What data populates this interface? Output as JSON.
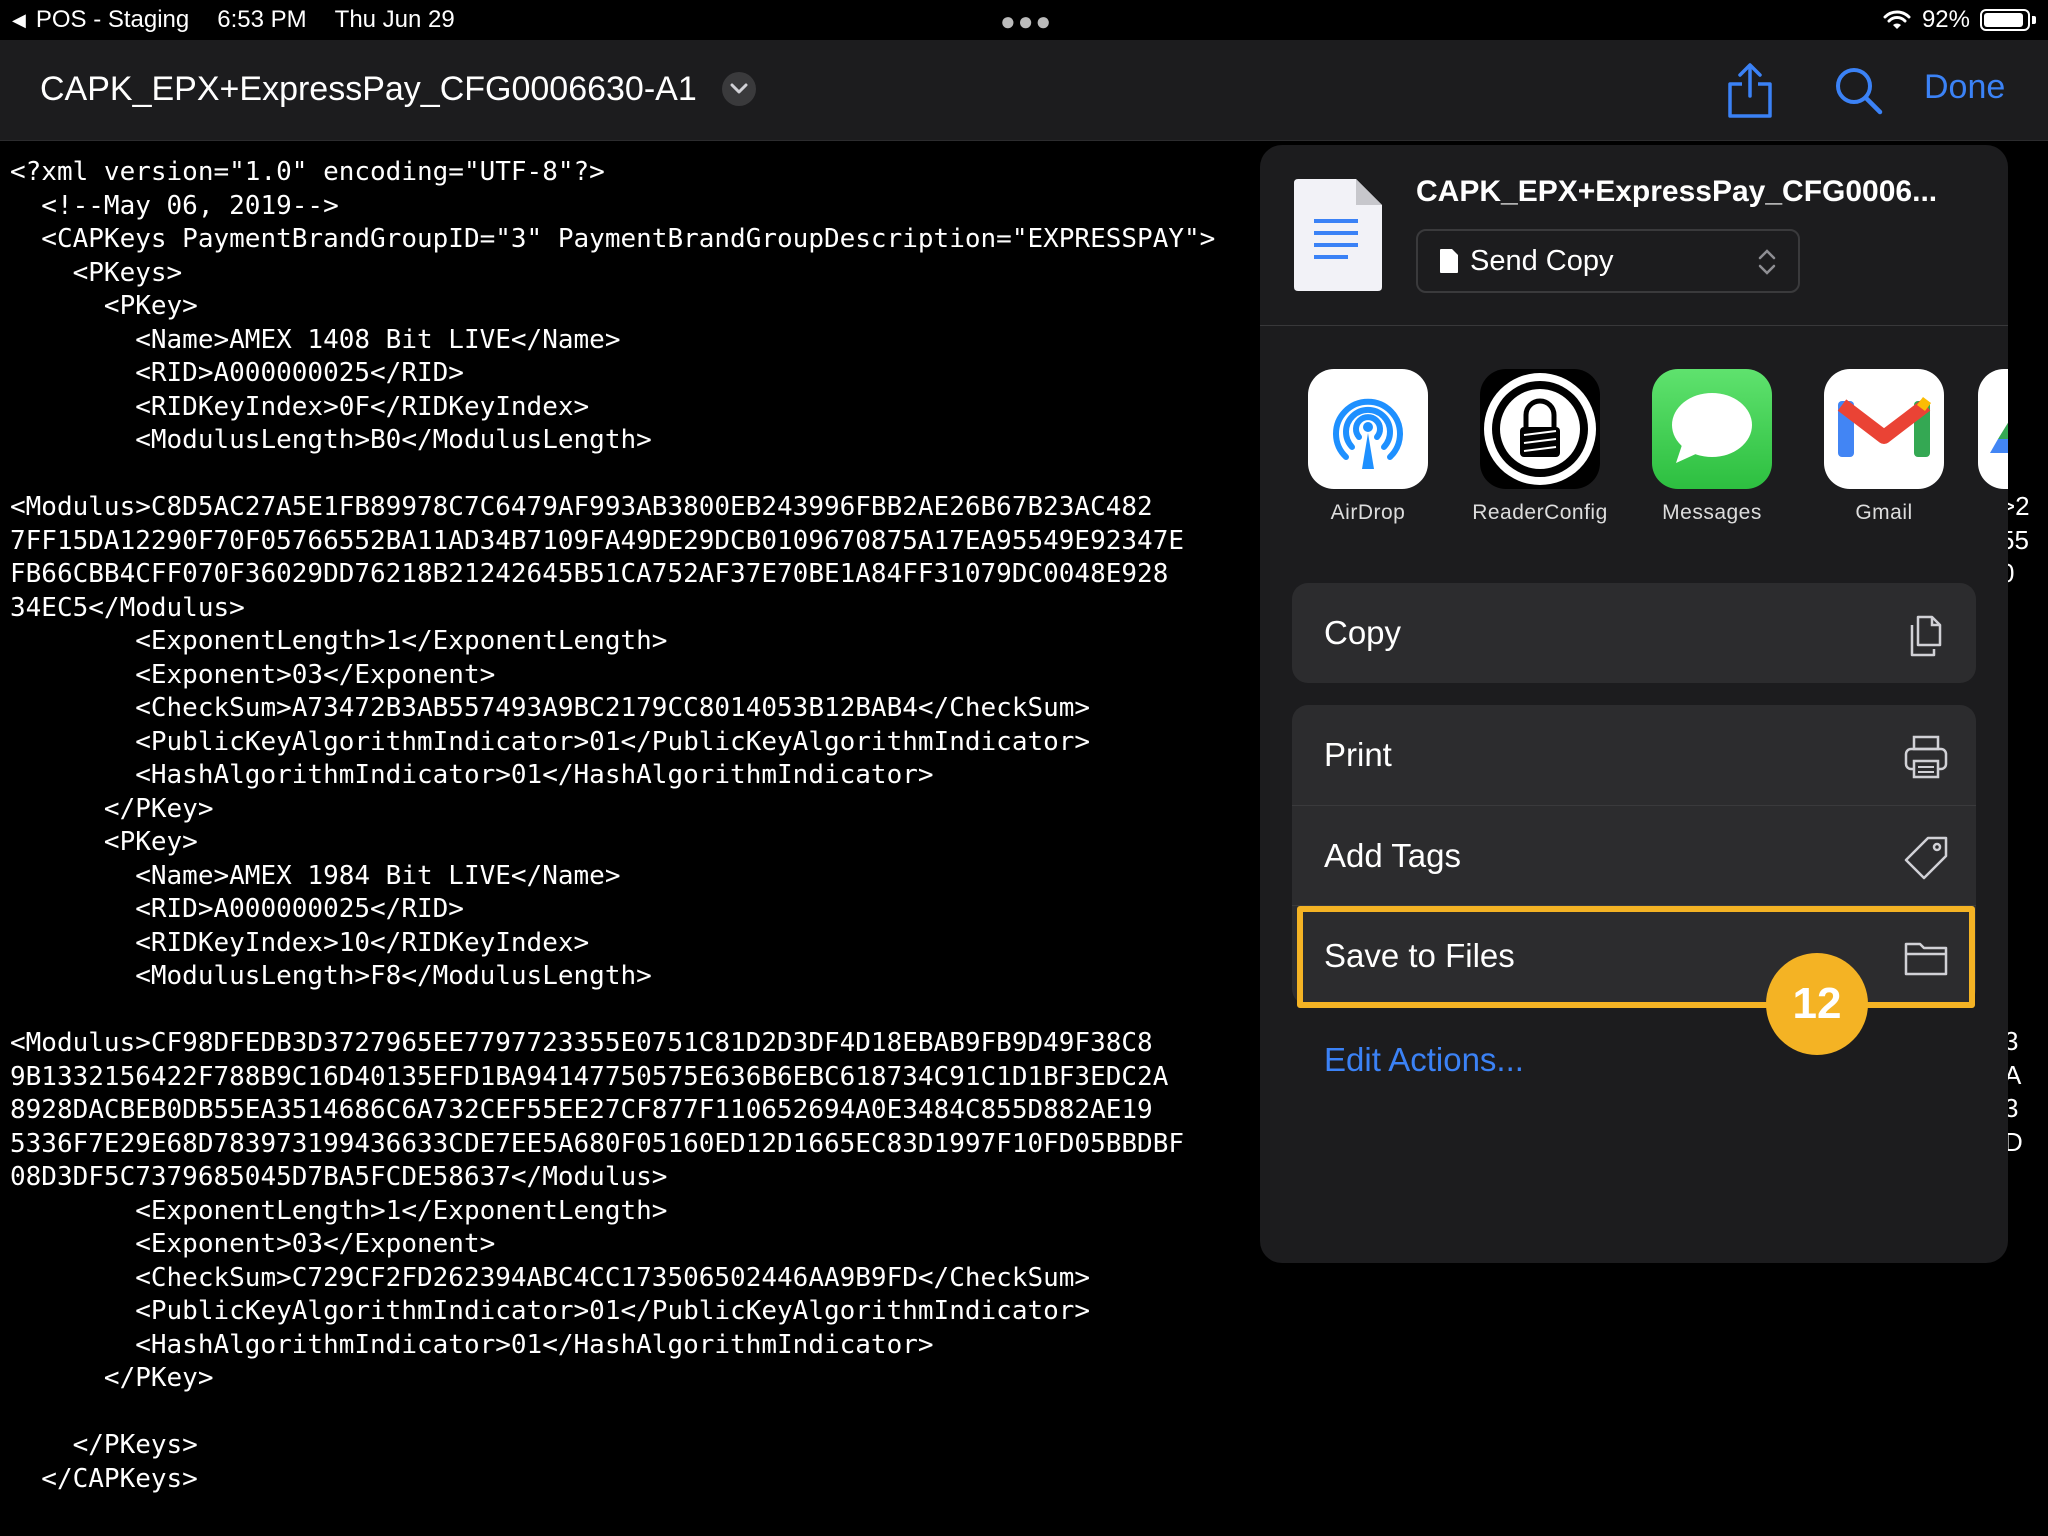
{
  "status_bar": {
    "back_app": "POS - Staging",
    "time": "6:53 PM",
    "date": "Thu Jun 29",
    "battery_percent": "92%",
    "battery_level": 0.92
  },
  "nav": {
    "title": "CAPK_EPX+ExpressPay_CFG0006630-A1",
    "done_label": "Done",
    "accent_color": "#3b82f6"
  },
  "document": {
    "lines": [
      "<?xml version=\"1.0\" encoding=\"UTF-8\"?>",
      "  <!--May 06, 2019-->",
      "  <CAPKeys PaymentBrandGroupID=\"3\" PaymentBrandGroupDescription=\"EXPRESSPAY\">",
      "    <PKeys>",
      "      <PKey>",
      "        <Name>AMEX 1408 Bit LIVE</Name>",
      "        <RID>A000000025</RID>",
      "        <RIDKeyIndex>0F</RIDKeyIndex>",
      "        <ModulusLength>B0</ModulusLength>",
      "",
      "<Modulus>C8D5AC27A5E1FB89978C7C6479AF993AB3800EB243996FBB2AE26B67B23AC482",
      "7FF15DA12290F70F05766552BA11AD34B7109FA49DE29DCB0109670875A17EA95549E92347E",
      "FB66CBB4CFF070F36029DD76218B21242645B51CA752AF37E70BE1A84FF31079DC0048E928",
      "34EC5</Modulus>",
      "        <ExponentLength>1</ExponentLength>",
      "        <Exponent>03</Exponent>",
      "        <CheckSum>A73472B3AB557493A9BC2179CC8014053B12BAB4</CheckSum>",
      "        <PublicKeyAlgorithmIndicator>01</PublicKeyAlgorithmIndicator>",
      "        <HashAlgorithmIndicator>01</HashAlgorithmIndicator>",
      "      </PKey>",
      "      <PKey>",
      "        <Name>AMEX 1984 Bit LIVE</Name>",
      "        <RID>A000000025</RID>",
      "        <RIDKeyIndex>10</RIDKeyIndex>",
      "        <ModulusLength>F8</ModulusLength>",
      "",
      "<Modulus>CF98DFEDB3D3727965EE7797723355E0751C81D2D3DF4D18EBAB9FB9D49F38C8",
      "9B1332156422F788B9C16D40135EFD1BA94147750575E636B6EBC618734C91C1D1BF3EDC2A",
      "8928DACBEB0DB55EA3514686C6A732CEF55EE27CF877F110652694A0E3484C855D882AE19",
      "5336F7E29E68D783973199436633CDE7EE5A680F05160ED12D1665EC83D1997F10FD05BBDBF",
      "08D3DF5C7379685045D7BA5FCDE58637</Modulus>",
      "        <ExponentLength>1</ExponentLength>",
      "        <Exponent>03</Exponent>",
      "        <CheckSum>C729CF2FD262394ABC4CC173506502446AA9B9FD</CheckSum>",
      "        <PublicKeyAlgorithmIndicator>01</PublicKeyAlgorithmIndicator>",
      "        <HashAlgorithmIndicator>01</HashAlgorithmIndicator>",
      "      </PKey>",
      "",
      "    </PKeys>",
      "  </CAPKeys>"
    ],
    "right_edge_1": ">2\n55\n0",
    "right_edge_2": "3\nA\n3\nD"
  },
  "share_sheet": {
    "file_name": "CAPK_EPX+ExpressPay_CFG0006...",
    "send_mode": "Send Copy",
    "apps": [
      {
        "label": "AirDrop",
        "icon": "airdrop-icon"
      },
      {
        "label": "ReaderConfig",
        "icon": "readerconfig-icon"
      },
      {
        "label": "Messages",
        "icon": "messages-icon"
      },
      {
        "label": "Gmail",
        "icon": "gmail-icon"
      }
    ],
    "actions": {
      "copy": "Copy",
      "print": "Print",
      "add_tags": "Add Tags",
      "save_to_files": "Save to Files"
    },
    "edit_actions": "Edit Actions..."
  },
  "annotation": {
    "step_number": "12",
    "highlight_color": "#f4b324"
  }
}
